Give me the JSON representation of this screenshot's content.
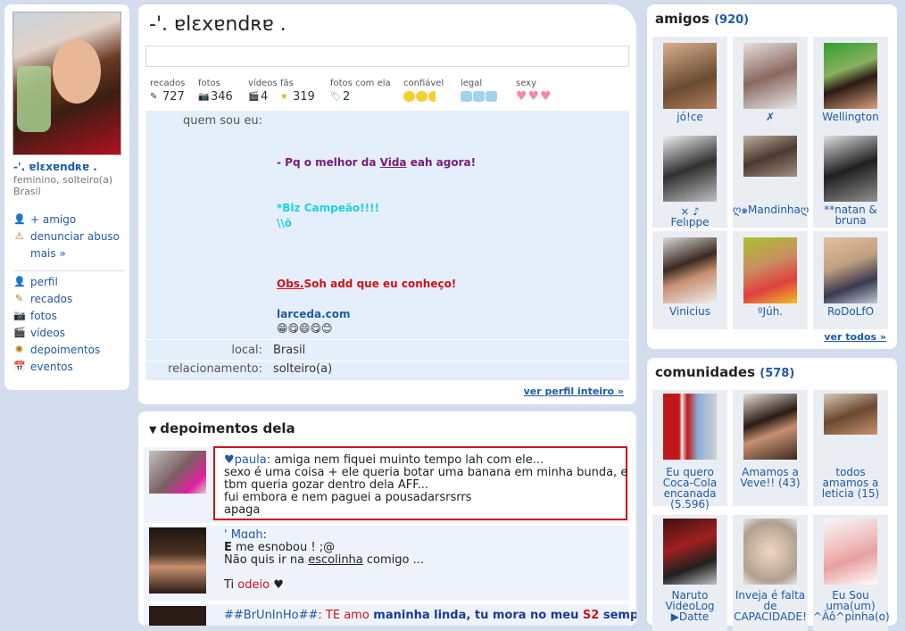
{
  "left": {
    "name": "-'. ɐlɛxɐndʀɐ .",
    "info1": "feminino, solteiro(a)",
    "info2": "Brasil",
    "actions": [
      "+ amigo",
      "denunciar abuso",
      "mais »"
    ],
    "nav": [
      "perfil",
      "recados",
      "fotos",
      "vídeos",
      "depoimentos",
      "eventos"
    ]
  },
  "main": {
    "title": "-'. ɐlɛxɐndʀɐ .",
    "stats": [
      {
        "label": "recados",
        "value": "727"
      },
      {
        "label": "fotos",
        "value": "346"
      },
      {
        "label": "vídeos",
        "value": "4"
      },
      {
        "label": "fãs",
        "value": "319"
      },
      {
        "label": "fotos com ela",
        "value": "2"
      }
    ],
    "ratings": [
      {
        "label": "confiável",
        "color": "#f2d030"
      },
      {
        "label": "legal",
        "color": "#9fd3ee"
      },
      {
        "label": "sexy",
        "color": "#f58aa6"
      }
    ],
    "about_label": "quem sou eu:",
    "about": {
      "line1_pre": "- Pq o melhor da ",
      "line1_link": "Vida",
      "line1_post": " eah agora!",
      "line2": "*Blz Campeão!!!!",
      "line3": "\\\\õ",
      "obs_link": "Obs.",
      "obs_text": "Soh add que eu conheço!",
      "site": "larceda.com",
      "emoji": "😁😋😄😋😊"
    },
    "local_label": "local:",
    "local": "Brasil",
    "rel_label": "relacionamento:",
    "rel": "solteiro(a)",
    "ver_perfil": "ver perfil inteiro »"
  },
  "testimonials": {
    "title": "depoimentos dela",
    "items": [
      {
        "author": "♥paula",
        "l1": ": amiga nem fiquei muinto tempo lah com ele...",
        "l2": "sexo é uma coisa + ele queria botar uma banana em minha bunda, e",
        "l3": "tbm queria gozar dentro dela AFF...",
        "l4": "fui embora e nem paguei a pousadarsrsrrs",
        "l5": "apaga"
      },
      {
        "author": "'  Mɑɑh",
        "l1_b": "E",
        "l1": " me esnobou ! ;@",
        "l2_pre": "Não quis ir na ",
        "l2_link": "escolinha",
        "l2_post": " comigo ...",
        "l4_pre": "Ti ",
        "l4_red": "odeio",
        "l4_post": " ♥"
      },
      {
        "author": "##BrUnInHo##",
        "text_red": ": TE amo",
        "text_blue": " maninha linda, tu mora no meu",
        "text_red2": " S2",
        "text_blue2": " sempre"
      }
    ]
  },
  "friends": {
    "title": "amigos",
    "count": "(920)",
    "items": [
      "jó!ce",
      "✗",
      "Wellington",
      "× ♪\nFelıppe",
      "ღ๑Mandinhaღ",
      "**natan &\nbruna",
      "Vinicius",
      "ºJúh.",
      "RoDoLfO"
    ],
    "see_all": "ver todos »"
  },
  "communities": {
    "title": "comunidades",
    "count": "(578)",
    "items": [
      "Eu quero\nCoca-Cola\nencanada\n(5.596)",
      "Amamos a\nVeve!! (43)",
      "todos\namamos a\nleticia (15)",
      "Naruto\nVideoLog\n▶Datte",
      "Inveja é falta\nde\nCAPACIDADE!",
      "Eu Sou\numa(um)\n^Âô^pinha(o)"
    ]
  }
}
